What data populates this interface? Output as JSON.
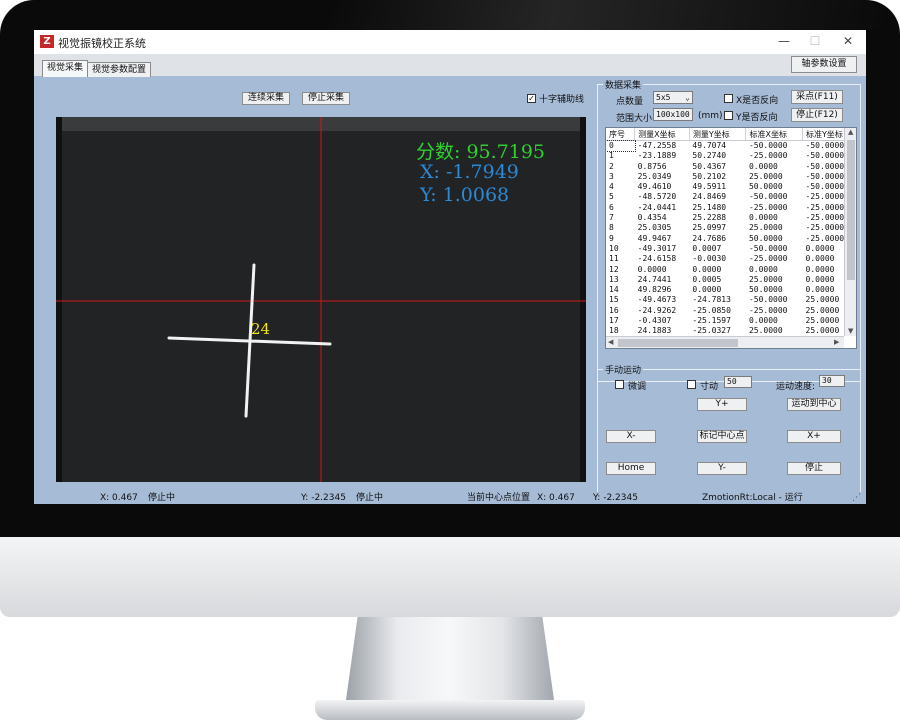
{
  "window": {
    "title": "视觉振镜校正系统",
    "logo_letter": "Z",
    "minimize": "—",
    "maximize": "☐",
    "close": "✕"
  },
  "toolbar": {
    "axis_params_button": "轴参数设置"
  },
  "tabs": [
    {
      "label": "视觉采集",
      "active": true
    },
    {
      "label": "视觉参数配置",
      "active": false
    }
  ],
  "capture": {
    "continuous_button": "连续采集",
    "stop_button": "停止采集",
    "crosshair_label": "十字辅助线",
    "crosshair_checked": true
  },
  "overlay": {
    "score": "分数: 95.7195",
    "x": "X: -1.7949",
    "y": "Y: 1.0068",
    "marker": "24"
  },
  "data_collection": {
    "group_title": "数据采集",
    "points_label": "点数量",
    "points_value": "5x5",
    "range_label": "范围大小",
    "range_value": "100x100",
    "range_unit": "(mm)",
    "x_reverse_label": "X是否反向",
    "y_reverse_label": "Y是否反向",
    "sample_button": "采点(F11)",
    "stop_button": "停止(F12)",
    "columns": [
      "序号",
      "测量X坐标",
      "测量Y坐标",
      "标准X坐标",
      "标准Y坐标"
    ],
    "rows": [
      [
        "0",
        "-47.2558",
        "49.7074",
        "-50.0000",
        "-50.0000"
      ],
      [
        "1",
        "-23.1889",
        "50.2740",
        "-25.0000",
        "-50.0000"
      ],
      [
        "2",
        "0.8756",
        "50.4367",
        "0.0000",
        "-50.0000"
      ],
      [
        "3",
        "25.0349",
        "50.2102",
        "25.0000",
        "-50.0000"
      ],
      [
        "4",
        "49.4610",
        "49.5911",
        "50.0000",
        "-50.0000"
      ],
      [
        "5",
        "-48.5720",
        "24.8469",
        "-50.0000",
        "-25.0000"
      ],
      [
        "6",
        "-24.0441",
        "25.1480",
        "-25.0000",
        "-25.0000"
      ],
      [
        "7",
        "0.4354",
        "25.2288",
        "0.0000",
        "-25.0000"
      ],
      [
        "8",
        "25.0305",
        "25.0997",
        "25.0000",
        "-25.0000"
      ],
      [
        "9",
        "49.9467",
        "24.7686",
        "50.0000",
        "-25.0000"
      ],
      [
        "10",
        "-49.3017",
        "0.0007",
        "-50.0000",
        "0.0000"
      ],
      [
        "11",
        "-24.6158",
        "-0.0030",
        "-25.0000",
        "0.0000"
      ],
      [
        "12",
        "0.0000",
        "0.0000",
        "0.0000",
        "0.0000"
      ],
      [
        "13",
        "24.7441",
        "0.0005",
        "25.0000",
        "0.0000"
      ],
      [
        "14",
        "49.8296",
        "0.0000",
        "50.0000",
        "0.0000"
      ],
      [
        "15",
        "-49.4673",
        "-24.7813",
        "-50.0000",
        "25.0000"
      ],
      [
        "16",
        "-24.9262",
        "-25.0850",
        "-25.0000",
        "25.0000"
      ],
      [
        "17",
        "-0.4307",
        "-25.1597",
        "0.0000",
        "25.0000"
      ],
      [
        "18",
        "24.1883",
        "-25.0327",
        "25.0000",
        "25.0000"
      ]
    ]
  },
  "manual": {
    "group_title": "手动运动",
    "fine_label": "微调",
    "inch_label": "寸动",
    "inch_value": "50",
    "speed_label": "运动速度:",
    "speed_value": "30",
    "y_plus": "Y+",
    "move_center": "运动到中心",
    "x_minus": "X-",
    "mark_center": "标记中心点",
    "x_plus": "X+",
    "home": "Home",
    "y_minus": "Y-",
    "stop": "停止"
  },
  "statusbar": {
    "x": "X: 0.467",
    "state1": "停止中",
    "y": "Y: -2.2345",
    "state2": "停止中",
    "center_label": "当前中心点位置",
    "center_x": "X: 0.467",
    "center_y": "Y: -2.2345",
    "connection": "ZmotionRt:Local - 运行"
  }
}
